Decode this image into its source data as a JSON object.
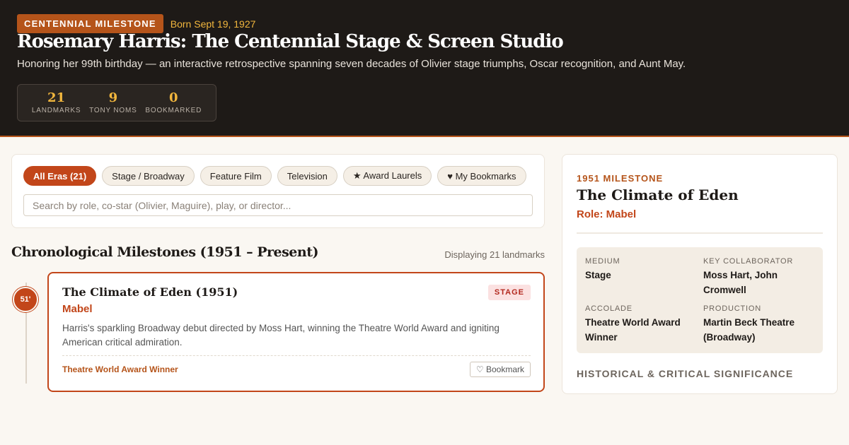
{
  "header": {
    "badge": "CENTENNIAL MILESTONE",
    "born": "Born Sept 19, 1927",
    "title": "Rosemary Harris: The Centennial Stage & Screen Studio",
    "subtitle": "Honoring her 99th birthday — an interactive retrospective spanning seven decades of Olivier stage triumphs, Oscar recognition, and Aunt May.",
    "stats": [
      {
        "value": "21",
        "label": "LANDMARKS"
      },
      {
        "value": "9",
        "label": "TONY NOMS"
      },
      {
        "value": "0",
        "label": "BOOKMARKED"
      }
    ]
  },
  "filters": {
    "chips": [
      {
        "label": "All Eras (21)",
        "active": true
      },
      {
        "label": "Stage / Broadway",
        "active": false
      },
      {
        "label": "Feature Film",
        "active": false
      },
      {
        "label": "Television",
        "active": false
      },
      {
        "label": "★ Award Laurels",
        "active": false
      },
      {
        "label": "♥ My Bookmarks",
        "active": false
      }
    ],
    "search_placeholder": "Search by role, co-star (Olivier, Maguire), play, or director..."
  },
  "timeline": {
    "title": "Chronological Milestones (1951 – Present)",
    "count": "Displaying 21 landmarks",
    "entries": [
      {
        "year_badge": "51'",
        "title": "The Climate of Eden (1951)",
        "role": "Mabel",
        "tag": "STAGE",
        "description": "Harris's sparkling Broadway debut directed by Moss Hart, winning the Theatre World Award and igniting American critical admiration.",
        "award": "Theatre World Award Winner",
        "bookmark_label": "♡ Bookmark"
      }
    ]
  },
  "detail": {
    "kicker": "1951 MILESTONE",
    "title": "The Climate of Eden",
    "role": "Role: Mabel",
    "facts": [
      {
        "label": "MEDIUM",
        "value": "Stage"
      },
      {
        "label": "KEY COLLABORATOR",
        "value": "Moss Hart, John Cromwell"
      },
      {
        "label": "ACCOLADE",
        "value": "Theatre World Award Winner"
      },
      {
        "label": "PRODUCTION",
        "value": "Martin Beck Theatre (Broadway)"
      }
    ],
    "significance_heading": "HISTORICAL & CRITICAL SIGNIFICANCE"
  }
}
